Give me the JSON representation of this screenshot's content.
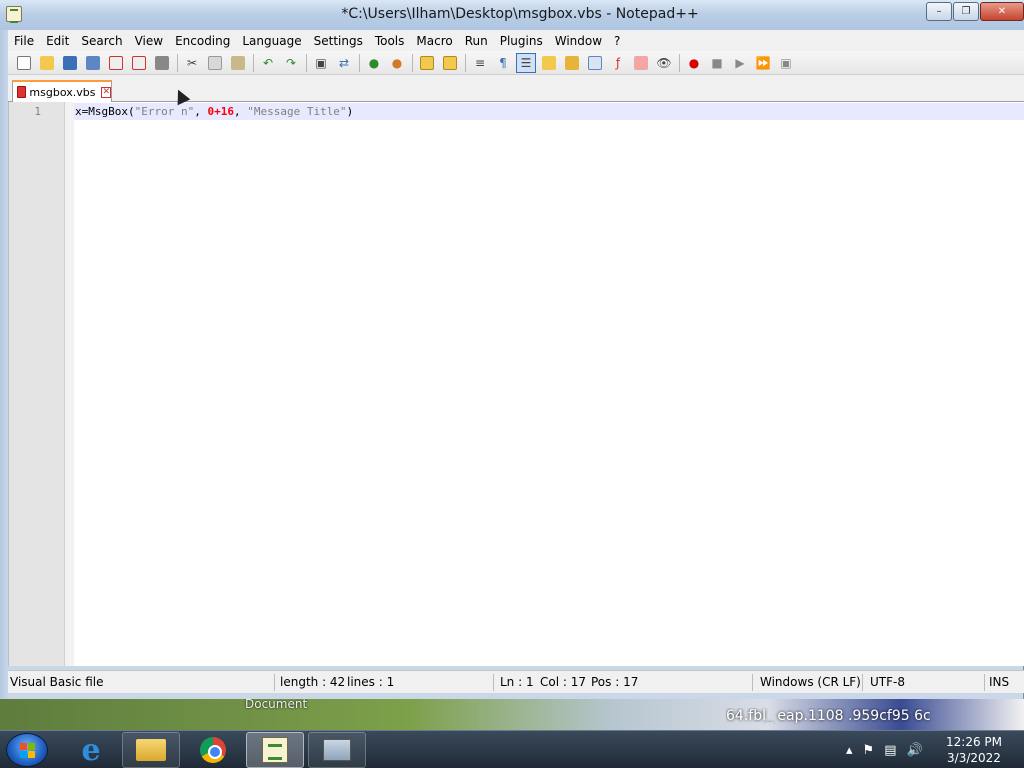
{
  "window": {
    "title": "*C:\\Users\\Ilham\\Desktop\\msgbox.vbs - Notepad++"
  },
  "menu": {
    "items": [
      "File",
      "Edit",
      "Search",
      "View",
      "Encoding",
      "Language",
      "Settings",
      "Tools",
      "Macro",
      "Run",
      "Plugins",
      "Window",
      "?"
    ]
  },
  "toolbar": {
    "icons": [
      "new-file-icon",
      "open-file-icon",
      "save-icon",
      "save-all-icon",
      "close-icon",
      "close-all-icon",
      "print-icon",
      "cut-icon",
      "copy-icon",
      "paste-icon",
      "undo-icon",
      "redo-icon",
      "find-icon",
      "replace-icon",
      "zoom-in-icon",
      "zoom-out-icon",
      "sync-vertical-icon",
      "sync-horizontal-icon",
      "word-wrap-icon",
      "show-all-chars-icon",
      "indent-guide-icon",
      "language-icon",
      "doc-map-icon",
      "doc-list-icon",
      "function-list-icon",
      "folder-workspace-icon",
      "monitoring-icon",
      "record-macro-icon",
      "stop-macro-icon",
      "play-macro-icon",
      "run-macro-multiple-icon",
      "save-macro-icon"
    ]
  },
  "tabs": [
    {
      "label": "msgbox.vbs",
      "active": true,
      "modified": true
    }
  ],
  "editor": {
    "line_number": "1",
    "tokens": [
      {
        "text": "x=MsgBox(",
        "kind": "ident"
      },
      {
        "text": "\"Error n\"",
        "kind": "string"
      },
      {
        "text": ", ",
        "kind": "ident"
      },
      {
        "text": "0+16",
        "kind": "number"
      },
      {
        "text": ", ",
        "kind": "ident"
      },
      {
        "text": "\"Message Title\"",
        "kind": "string"
      },
      {
        "text": ")",
        "kind": "ident"
      }
    ]
  },
  "statusbar": {
    "file_type": "Visual Basic file",
    "length": "length : 42",
    "lines": "lines : 1",
    "ln": "Ln : 1",
    "col": "Col : 17",
    "pos": "Pos : 17",
    "eol": "Windows (CR LF)",
    "encoding": "UTF-8",
    "mode": "INS"
  },
  "desktop": {
    "label": "Document",
    "overlay_text": "64.fbl_ eap.1108 .959cf95 6c"
  },
  "taskbar": {
    "apps": [
      "internet-explorer-icon",
      "file-explorer-icon",
      "chrome-icon",
      "notepadpp-icon",
      "performance-monitor-icon"
    ],
    "time": "12:26 PM",
    "date": "3/3/2022"
  },
  "colors": {
    "tab_accent": "#fa9c3a",
    "current_line": "#e8e8ff",
    "string": "#808080",
    "number": "#ff0000"
  }
}
